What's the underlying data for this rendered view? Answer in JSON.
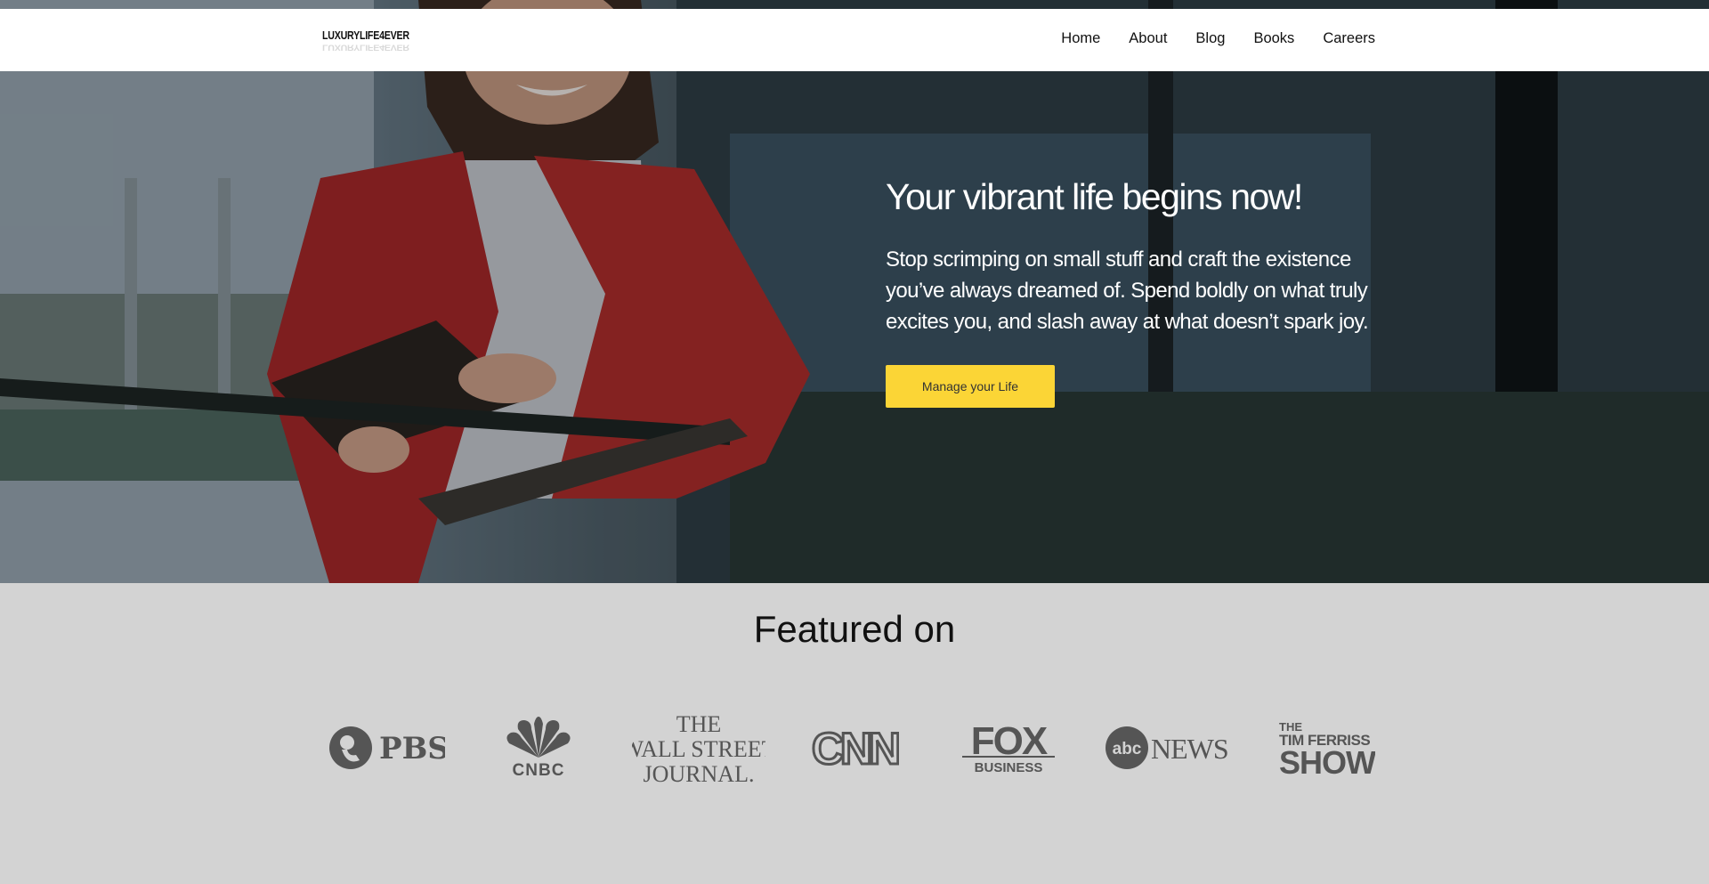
{
  "brand": {
    "name": "LUXURYLIFE4EVER"
  },
  "nav": {
    "items": [
      "Home",
      "About",
      "Blog",
      "Books",
      "Careers"
    ]
  },
  "hero": {
    "title": "Your vibrant life begins now!",
    "subtitle": "Stop scrimping on small stuff and craft the existence you’ve always dreamed of. Spend boldly on what truly excites you, and slash away at what doesn’t spark joy.",
    "cta_label": "Manage your Life"
  },
  "featured": {
    "title": "Featured on",
    "logos": [
      {
        "name": "PBS",
        "icon": "pbs-logo"
      },
      {
        "name": "CNBC",
        "icon": "cnbc-logo"
      },
      {
        "name": "THE WALL STREET JOURNAL.",
        "icon": "wsj-logo",
        "lines": [
          "THE",
          "WALL STREET",
          "JOURNAL."
        ]
      },
      {
        "name": "CNN",
        "icon": "cnn-logo"
      },
      {
        "name": "FOX BUSINESS",
        "icon": "fox-business-logo",
        "lines": [
          "FOX",
          "BUSINESS"
        ]
      },
      {
        "name": "abcNEWS",
        "icon": "abc-news-logo",
        "lines": [
          "abc",
          "NEWS"
        ]
      },
      {
        "name": "THE TIM FERRISS SHOW",
        "icon": "tim-ferriss-show-logo",
        "lines": [
          "THE",
          "TIM FERRISS",
          "SHOW"
        ]
      }
    ]
  },
  "colors": {
    "accent": "#fbd536",
    "featured_bg": "#d3d3d3",
    "logo_gray": "#555555"
  }
}
